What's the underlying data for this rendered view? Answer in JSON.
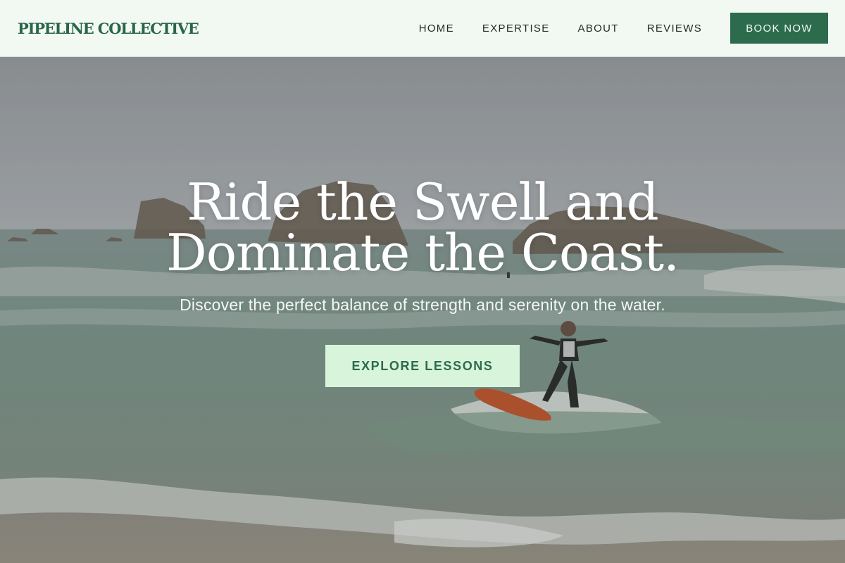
{
  "brand": {
    "name": "PIPELINE COLLECTIVE"
  },
  "nav": {
    "links": [
      {
        "label": "HOME"
      },
      {
        "label": "EXPERTISE"
      },
      {
        "label": "ABOUT"
      },
      {
        "label": "REVIEWS"
      }
    ],
    "cta_label": "BOOK NOW"
  },
  "hero": {
    "title_line1": "Ride the Swell and",
    "title_line2": "Dominate the Coast.",
    "subtitle": "Discover the perfect balance of strength and serenity on the water.",
    "cta_label": "EXPLORE LESSONS",
    "image_description_icon": "surfer-photo"
  },
  "colors": {
    "header_bg": "#f1f9f2",
    "brand_green": "#2d6b4d",
    "cta_light": "#d8f5db"
  }
}
